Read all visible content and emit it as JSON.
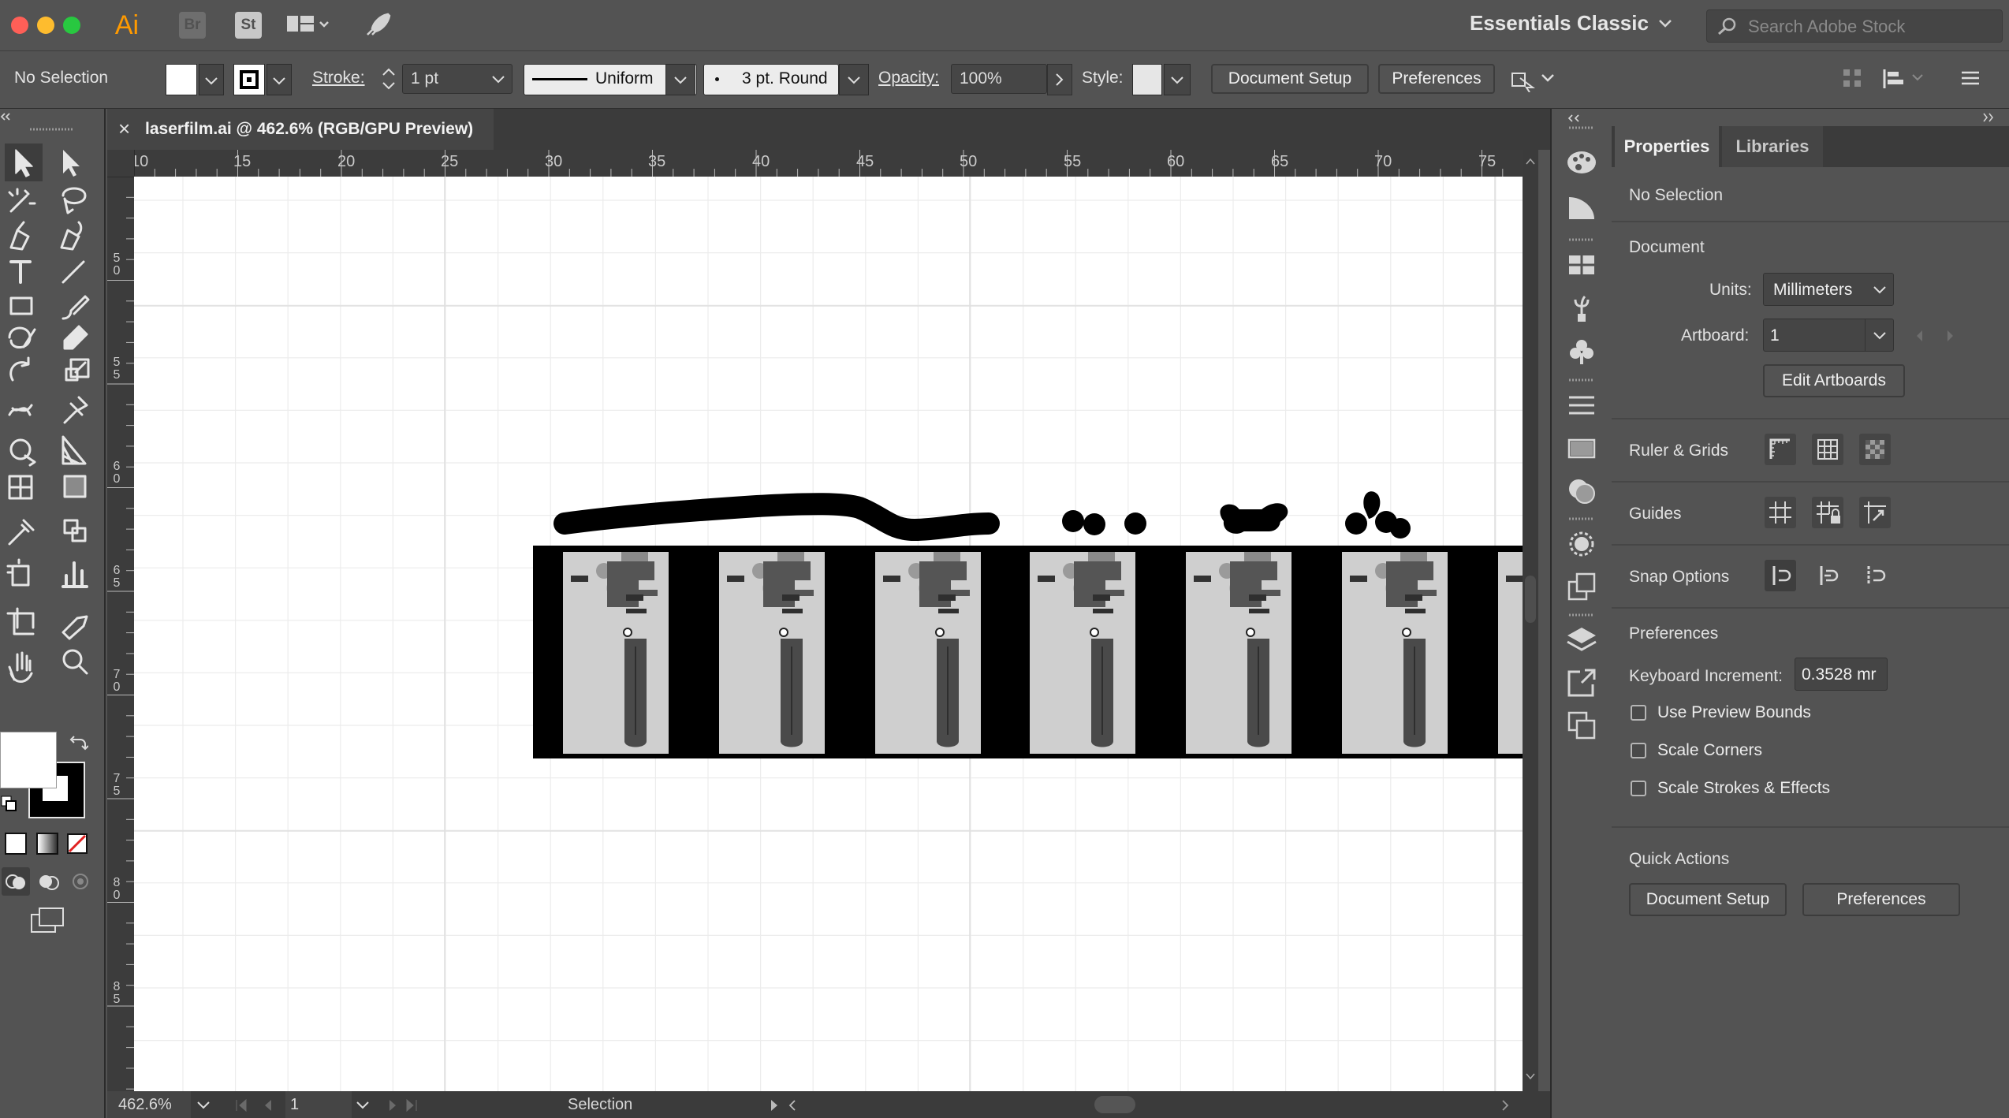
{
  "app": {
    "logo": "Ai",
    "bridge": "Br",
    "stock": "St",
    "workspace": "Essentials Classic",
    "search_placeholder": "Search Adobe Stock"
  },
  "control_bar": {
    "selection_status": "No Selection",
    "stroke_label": "Stroke:",
    "stroke_value": "1 pt",
    "stroke_profile": "Uniform",
    "brush": "3 pt. Round",
    "opacity_label": "Opacity:",
    "opacity_value": "100%",
    "style_label": "Style:",
    "document_setup": "Document Setup",
    "preferences": "Preferences"
  },
  "document": {
    "tab_title": "laserfilm.ai @ 462.6% (RGB/GPU Preview)",
    "close_glyph": "×"
  },
  "ruler": {
    "horizontal": [
      "10",
      "15",
      "20",
      "25",
      "30",
      "35",
      "40",
      "45",
      "50",
      "55",
      "60",
      "65",
      "70",
      "75"
    ],
    "vertical": [
      [
        "5",
        "0"
      ],
      [
        "5",
        "5"
      ],
      [
        "6",
        "0"
      ],
      [
        "6",
        "5"
      ],
      [
        "7",
        "0"
      ],
      [
        "7",
        "5"
      ],
      [
        "8",
        "0"
      ],
      [
        "8",
        "5"
      ]
    ]
  },
  "status": {
    "zoom": "462.6%",
    "artboard": "1",
    "tool": "Selection"
  },
  "properties": {
    "tab_properties": "Properties",
    "tab_libraries": "Libraries",
    "selection": "No Selection",
    "document_header": "Document",
    "units_label": "Units:",
    "units_value": "Millimeters",
    "artboard_label": "Artboard:",
    "artboard_value": "1",
    "edit_artboards": "Edit Artboards",
    "ruler_grids": "Ruler & Grids",
    "guides": "Guides",
    "snap_options": "Snap Options",
    "preferences_header": "Preferences",
    "keyboard_increment_label": "Keyboard Increment:",
    "keyboard_increment_value": "0.3528 mr",
    "use_preview_bounds": "Use Preview Bounds",
    "scale_corners": "Scale Corners",
    "scale_strokes": "Scale Strokes & Effects",
    "quick_actions": "Quick Actions",
    "qa_document_setup": "Document Setup",
    "qa_preferences": "Preferences"
  },
  "colors": {
    "chrome": "#535353",
    "dark_chrome": "#3b3b3b",
    "canvas": "#ffffff",
    "grid": "#e6e6e6",
    "film": "#000000",
    "frame": "#cfcfcf",
    "ai_brand": "#ff9a00"
  }
}
